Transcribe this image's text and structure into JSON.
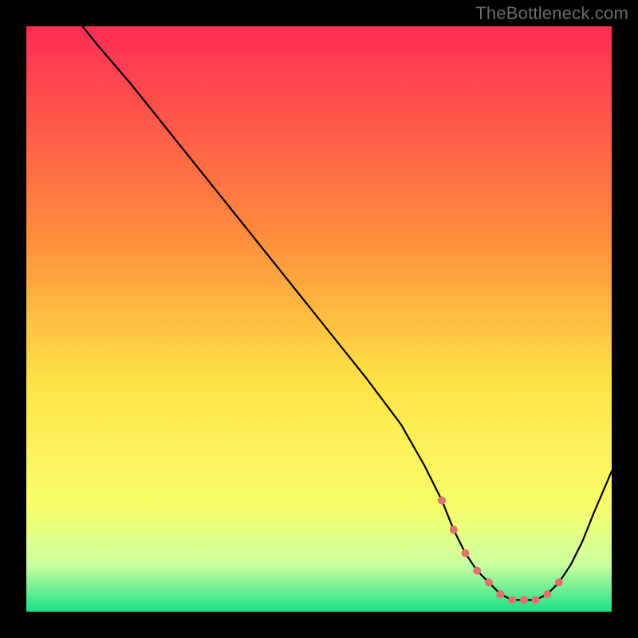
{
  "attribution": "TheBottleneck.com",
  "chart_data": {
    "type": "line",
    "title": "",
    "xlabel": "",
    "ylabel": "",
    "xlim": [
      0,
      100
    ],
    "ylim": [
      0,
      100
    ],
    "x": [
      0,
      4,
      8,
      12,
      18,
      26,
      34,
      42,
      50,
      58,
      64,
      68,
      71,
      73,
      75,
      77,
      79,
      81,
      83,
      85,
      87,
      89,
      91,
      93,
      95,
      97,
      100
    ],
    "values": [
      115,
      108,
      102,
      97,
      90,
      80,
      70,
      60,
      50,
      40,
      32,
      25,
      19,
      14,
      10,
      7,
      5,
      3,
      2,
      2,
      2,
      3,
      5,
      8,
      12,
      17,
      24
    ],
    "marker_x": [
      71,
      73,
      75,
      77,
      79,
      81,
      83,
      85,
      87,
      89,
      91
    ],
    "marker_values": [
      19,
      14,
      10,
      7,
      5,
      3,
      2,
      2,
      2,
      3,
      5
    ],
    "curve_color": "#000000",
    "marker_color": "#e36f6f",
    "gradient_stops": [
      {
        "offset": 0.0,
        "color": "#ff2d55"
      },
      {
        "offset": 0.35,
        "color": "#ff8a3c"
      },
      {
        "offset": 0.6,
        "color": "#ffe146"
      },
      {
        "offset": 0.82,
        "color": "#f8ff6a"
      },
      {
        "offset": 0.92,
        "color": "#ccffa0"
      },
      {
        "offset": 1.0,
        "color": "#1adf87"
      }
    ]
  }
}
